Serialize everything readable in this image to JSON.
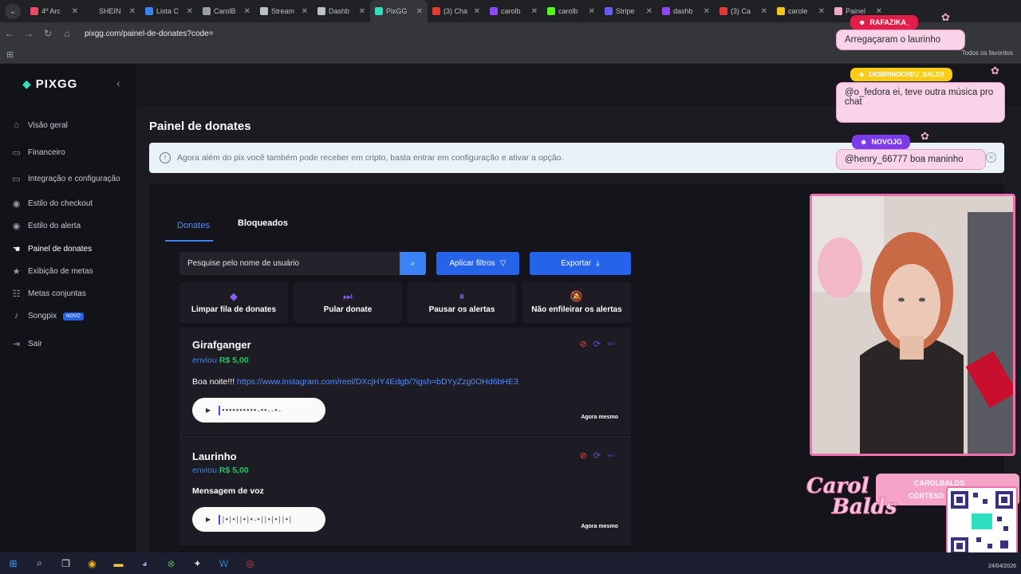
{
  "browser": {
    "tabs": [
      {
        "title": "4º Arc",
        "color": "#e84a5f"
      },
      {
        "title": "SHEIN",
        "color": "#222222"
      },
      {
        "title": "Lista C",
        "color": "#3b82f6"
      },
      {
        "title": "CarolB",
        "color": "#9aa0a6"
      },
      {
        "title": "Stream",
        "color": "#bdc1c6"
      },
      {
        "title": "Dashb",
        "color": "#bdc1c6"
      },
      {
        "title": "PixGG",
        "color": "#2fe0c0"
      },
      {
        "title": "(3) Cha",
        "color": "#e53935"
      },
      {
        "title": "carolb",
        "color": "#9146ff"
      },
      {
        "title": "carolb",
        "color": "#53fc18"
      },
      {
        "title": "Stripe",
        "color": "#635bff"
      },
      {
        "title": "dashb",
        "color": "#9146ff"
      },
      {
        "title": "(3) Ca",
        "color": "#e53935"
      },
      {
        "title": "carole",
        "color": "#f5c518"
      },
      {
        "title": "Painel",
        "color": "#f4a6c9"
      }
    ],
    "url": "pixgg.com/painel-de-donates?code=",
    "bookmarks_all": "Todos os favoritos"
  },
  "sidebar": {
    "brand": "PIXGG",
    "items": [
      {
        "label": "Visão geral",
        "icon": "home-icon"
      },
      {
        "label": "Financeiro",
        "icon": "wallet-icon"
      },
      {
        "label": "Integração e configuração",
        "icon": "settings-icon"
      },
      {
        "label": "Estilo do checkout",
        "icon": "palette-icon"
      },
      {
        "label": "Estilo do alerta",
        "icon": "palette-icon"
      },
      {
        "label": "Painel de donates",
        "icon": "donate-icon"
      },
      {
        "label": "Exibição de metas",
        "icon": "star-icon"
      },
      {
        "label": "Metas conjuntas",
        "icon": "users-icon"
      },
      {
        "label": "Songpix",
        "icon": "music-icon",
        "badge": "NOVO"
      },
      {
        "label": "Sair",
        "icon": "logout-icon"
      }
    ]
  },
  "main": {
    "title": "Painel de donates",
    "notice": "Agora além do pix você também pode receber em cripto, basta entrar em configuração e ativar a opção.",
    "tabs": [
      "Donates",
      "Bloqueados"
    ],
    "search_placeholder": "Pesquise pelo nome de usuário",
    "filters_label": "Aplicar filtros",
    "export_label": "Exportar",
    "actions": [
      {
        "label": "Limpar fila de donates",
        "icon": "eraser-icon"
      },
      {
        "label": "Pular donate",
        "icon": "skip-icon"
      },
      {
        "label": "Pausar os alertas",
        "icon": "pause-icon"
      },
      {
        "label": "Não enfileirar os alertas",
        "icon": "bell-off-icon"
      }
    ],
    "donates": [
      {
        "name": "Girafganger",
        "sent": "enviou",
        "amount": "R$ 5,00",
        "message_prefix": "Boa noite!!! ",
        "link": "https://www.instagram.com/reel/DXcjHY4Edgb/?igsh=bDYyZzg0OHd6bHE3",
        "time": "Agora mesmo"
      },
      {
        "name": "Laurinho",
        "sent": "enviou",
        "amount": "R$ 5,00",
        "message": "Mensagem de voz",
        "time": "Agora mesmo"
      }
    ]
  },
  "overlay": {
    "chats": [
      {
        "user": "RAFAZIKA_",
        "message": "Arregaçaram o laurinho"
      },
      {
        "user": "DIOBRINOCHEU_BALDS",
        "message": "@o_fedora ei, teve outra música pro chat"
      },
      {
        "user": "NOVOJG",
        "message": "@henry_66777 boa maninho"
      }
    ],
    "logo_text": "Carol Balds",
    "social_1": "CAROLBALDS",
    "social_2": "CORTESD"
  },
  "taskbar": {
    "date": "24/04/2026"
  }
}
